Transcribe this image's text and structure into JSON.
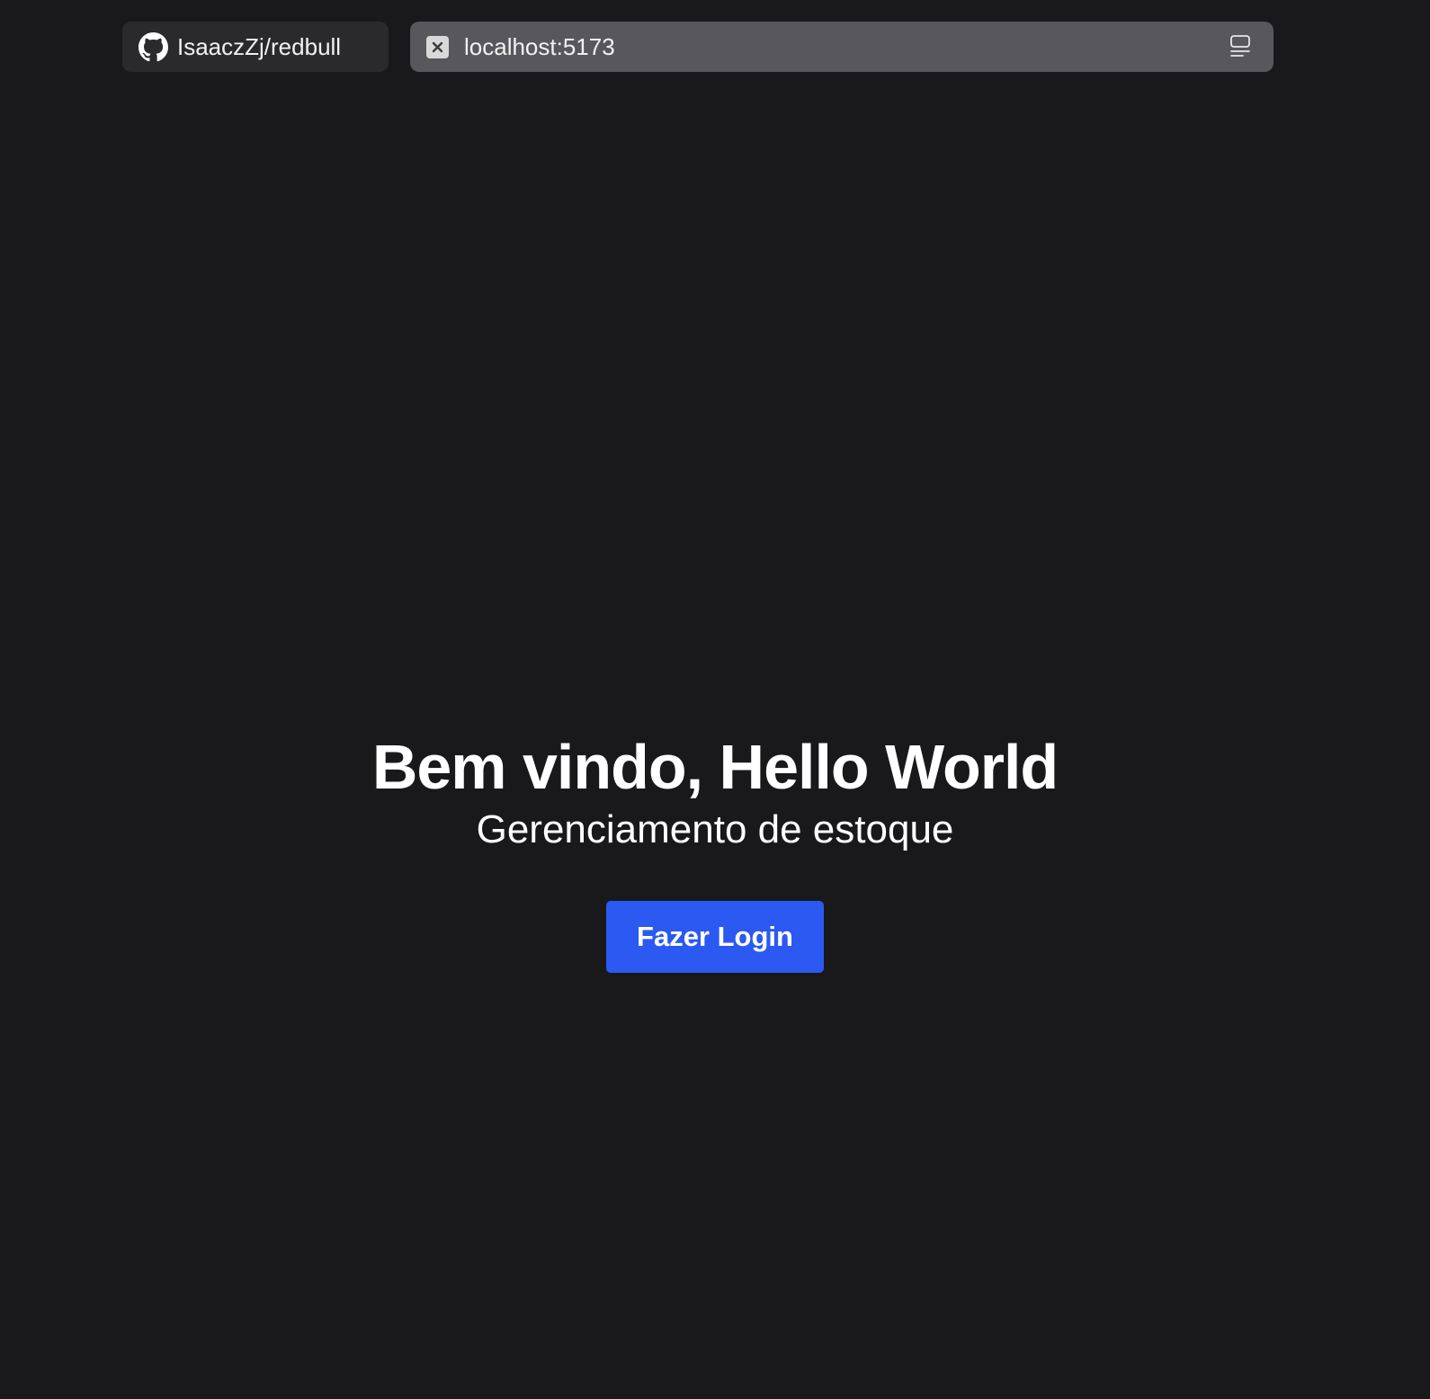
{
  "tabs": {
    "github_tab": {
      "label": "IsaaczZj/redbull",
      "icon": "github-icon"
    },
    "url_tab": {
      "url": "localhost:5173",
      "close_icon": "close-icon",
      "reader_icon": "reader-mode-icon"
    }
  },
  "main": {
    "title": "Bem vindo, Hello World",
    "subtitle": "Gerenciamento de estoque",
    "login_button_label": "Fazer Login"
  },
  "colors": {
    "background": "#19191c",
    "tab_background": "#2a2a2d",
    "url_background": "#58585c",
    "accent": "#2b59f2",
    "text": "#ffffff"
  }
}
